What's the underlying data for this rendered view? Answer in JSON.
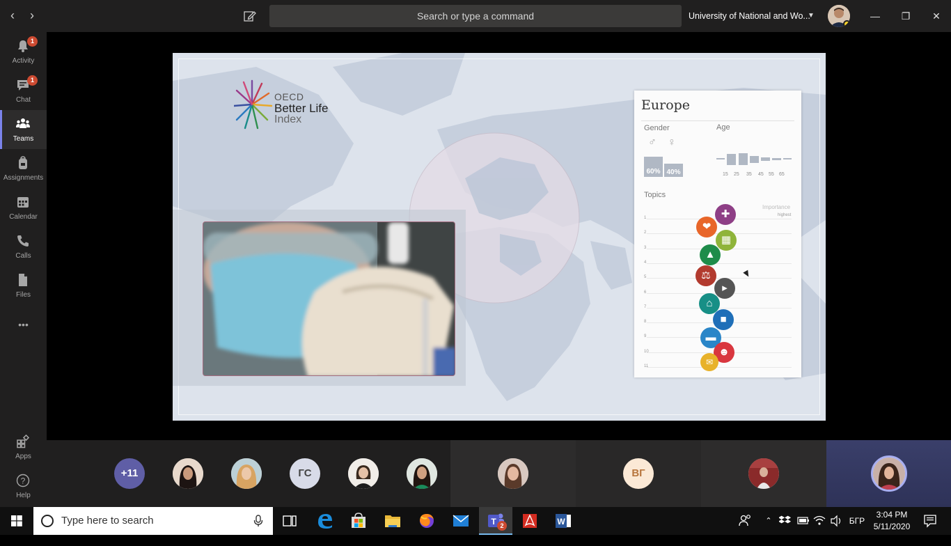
{
  "titlebar": {
    "search_placeholder": "Search or type a command",
    "org_name": "University of National and Wo...",
    "minimize": "—",
    "restore": "❐",
    "close": "✕"
  },
  "rail": {
    "items": [
      {
        "label": "Activity",
        "badge": "1",
        "icon": "bell-icon"
      },
      {
        "label": "Chat",
        "badge": "1",
        "icon": "chat-icon"
      },
      {
        "label": "Teams",
        "badge": "",
        "icon": "teams-icon"
      },
      {
        "label": "Assignments",
        "badge": "",
        "icon": "backpack-icon"
      },
      {
        "label": "Calendar",
        "badge": "",
        "icon": "calendar-icon"
      },
      {
        "label": "Calls",
        "badge": "",
        "icon": "phone-icon"
      },
      {
        "label": "Files",
        "badge": "",
        "icon": "file-icon"
      }
    ],
    "more": "•••",
    "apps_label": "Apps",
    "help_label": "Help"
  },
  "slide": {
    "logo_line1": "OECD",
    "logo_line2": "Better Life",
    "logo_line3": "Index",
    "panel": {
      "title": "Europe",
      "gender_label": "Gender",
      "age_label": "Age",
      "male_pct": "60%",
      "female_pct": "40%",
      "male_fraction": 0.6,
      "female_fraction": 0.4,
      "age_ticks": [
        "15",
        "25",
        "35",
        "45",
        "55",
        "65"
      ],
      "topics_label": "Topics",
      "importance_label": "Importance",
      "highest_label": "highest",
      "row_numbers": [
        "1",
        "2",
        "3",
        "4",
        "5",
        "6",
        "7",
        "8",
        "9",
        "10",
        "11"
      ]
    }
  },
  "participants": {
    "overflow": "+11",
    "initials_1": "ГС",
    "initials_2": "ВГ"
  },
  "taskbar": {
    "search_placeholder": "Type here to search",
    "language": "БГР",
    "time": "3:04 PM",
    "date": "5/11/2020",
    "teams_badge": "2"
  },
  "colors": {
    "accent": "#7b83eb",
    "rail_bg": "#201f1f",
    "badge": "#cc4a31"
  }
}
